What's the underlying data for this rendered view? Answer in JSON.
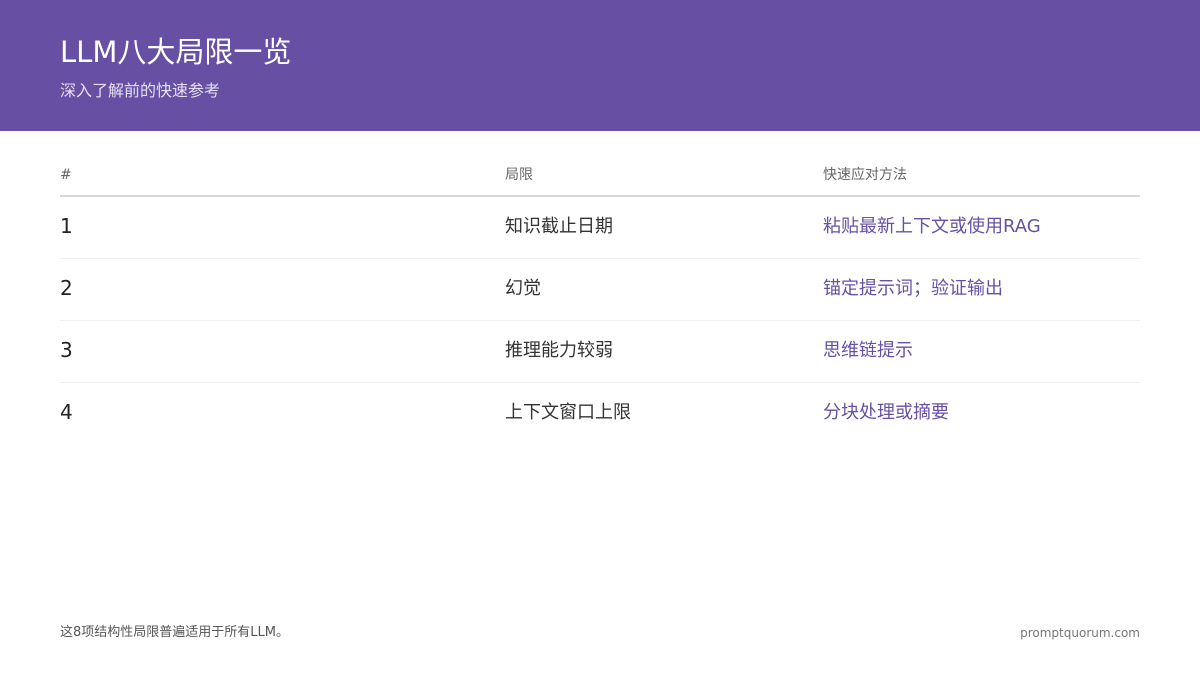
{
  "header": {
    "title": "LLM八大局限一览",
    "subtitle": "深入了解前的快速参考"
  },
  "table": {
    "columns": [
      "#",
      "局限",
      "快速应对方法"
    ],
    "rows": [
      {
        "num": "1",
        "limitation": "知识截止日期",
        "fix": "粘贴最新上下文或使用RAG"
      },
      {
        "num": "2",
        "limitation": "幻觉",
        "fix": "锚定提示词；验证输出"
      },
      {
        "num": "3",
        "limitation": "推理能力较弱",
        "fix": "思维链提示"
      },
      {
        "num": "4",
        "limitation": "上下文窗口上限",
        "fix": "分块处理或摘要"
      }
    ]
  },
  "footer": {
    "note": "这8项结构性局限普遍适用于所有LLM。",
    "site": "promptquorum.com"
  },
  "colors": {
    "accent": "#6750a4",
    "header_bg": "#6750a4"
  }
}
